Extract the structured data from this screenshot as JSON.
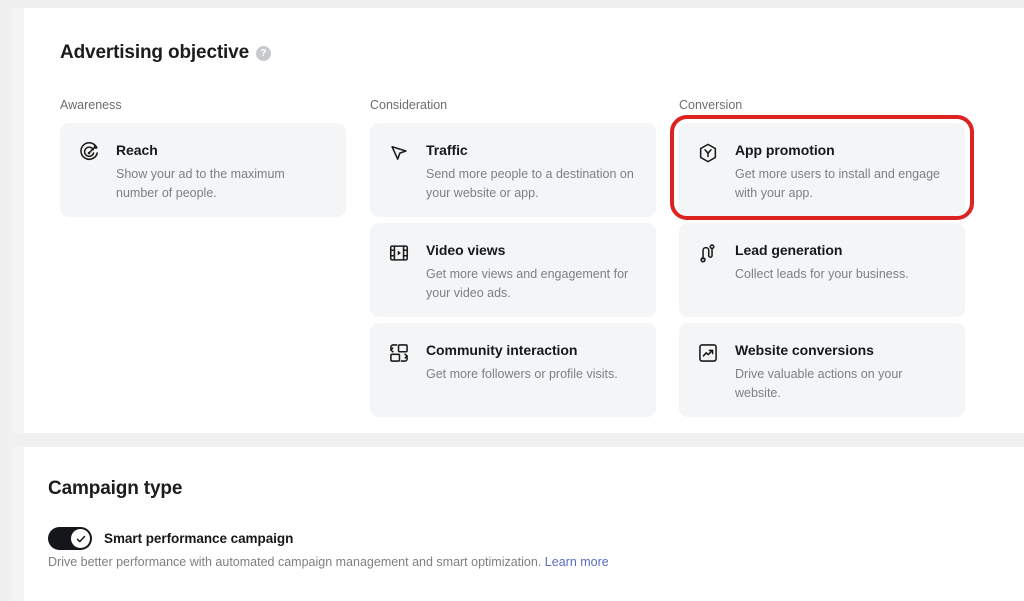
{
  "objective_section": {
    "title": "Advertising objective",
    "info_icon": "help-circle-icon",
    "info_glyph": "?",
    "columns": [
      {
        "label": "Awareness"
      },
      {
        "label": "Consideration"
      },
      {
        "label": "Conversion"
      }
    ],
    "cards": {
      "reach": {
        "title": "Reach",
        "description": "Show your ad to the maximum number of people.",
        "icon": "target-dart-icon"
      },
      "traffic": {
        "title": "Traffic",
        "description": "Send more people to a destination on your website or app.",
        "icon": "cursor-pointer-icon"
      },
      "video_views": {
        "title": "Video views",
        "description": "Get more views and engagement for your video ads.",
        "icon": "film-strip-play-icon"
      },
      "community_interaction": {
        "title": "Community interaction",
        "description": "Get more followers or profile visits.",
        "icon": "exchange-squares-icon"
      },
      "app_promotion": {
        "title": "App promotion",
        "description": "Get more users to install and engage with your app.",
        "icon": "hexagon-app-icon"
      },
      "lead_generation": {
        "title": "Lead generation",
        "description": "Collect leads for your business.",
        "icon": "magnet-icon"
      },
      "website_conversions": {
        "title": "Website conversions",
        "description": "Drive valuable actions on your website.",
        "icon": "trending-up-box-icon"
      }
    },
    "highlight": {
      "target": "app_promotion",
      "color": "#dd2222"
    }
  },
  "campaign_section": {
    "title": "Campaign type",
    "toggle": {
      "label": "Smart performance campaign",
      "state": "on",
      "icon": "check-icon"
    },
    "description": "Drive better performance with automated campaign management and smart optimization.",
    "learn_more": "Learn more",
    "link_color": "#5b6cc2"
  }
}
